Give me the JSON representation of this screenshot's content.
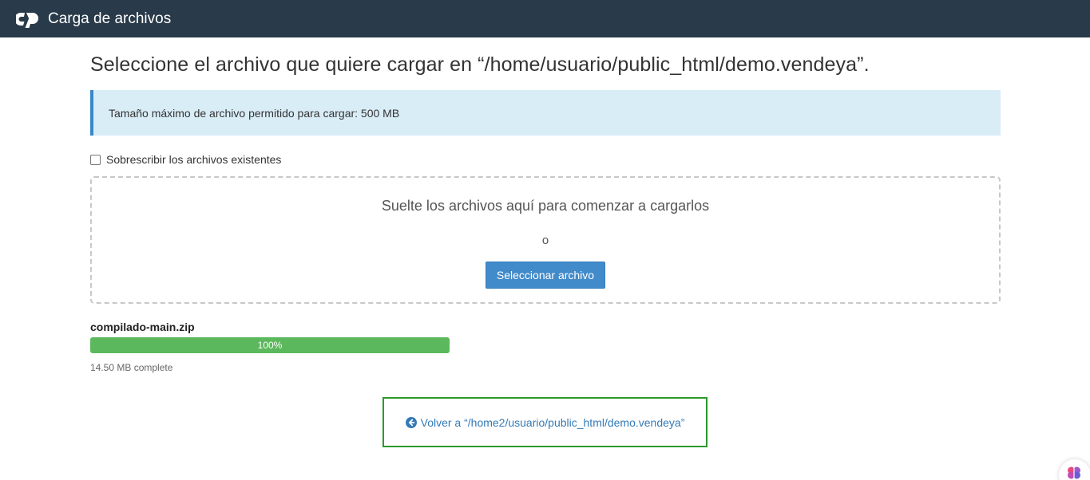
{
  "header": {
    "logo_icon": "cpanel-logo-icon",
    "title": "Carga de archivos"
  },
  "main": {
    "page_title": "Seleccione el archivo que quiere cargar en “/home/usuario/public_html/demo.vendeya”.",
    "info_text": "Tamaño máximo de archivo permitido para cargar: 500 MB",
    "overwrite_label": "Sobrescribir los archivos existentes",
    "overwrite_checked": false,
    "dropzone": {
      "drop_text": "Suelte los archivos aquí para comenzar a cargarlos",
      "or_text": "o",
      "select_button": "Seleccionar archivo"
    },
    "upload": {
      "file_name": "compilado-main.zip",
      "progress_percent": 100,
      "progress_label": "100%",
      "status": "14.50 MB complete"
    },
    "back_link": "Volver a “/home2/usuario/public_html/demo.vendeya”"
  },
  "colors": {
    "header_bg": "#293a4a",
    "info_bg": "#d9edf7",
    "info_border": "#3a87c8",
    "primary_button": "#428bca",
    "progress_fill": "#5cb85c",
    "back_box_border": "#2b9a2b",
    "link": "#337ab7"
  }
}
